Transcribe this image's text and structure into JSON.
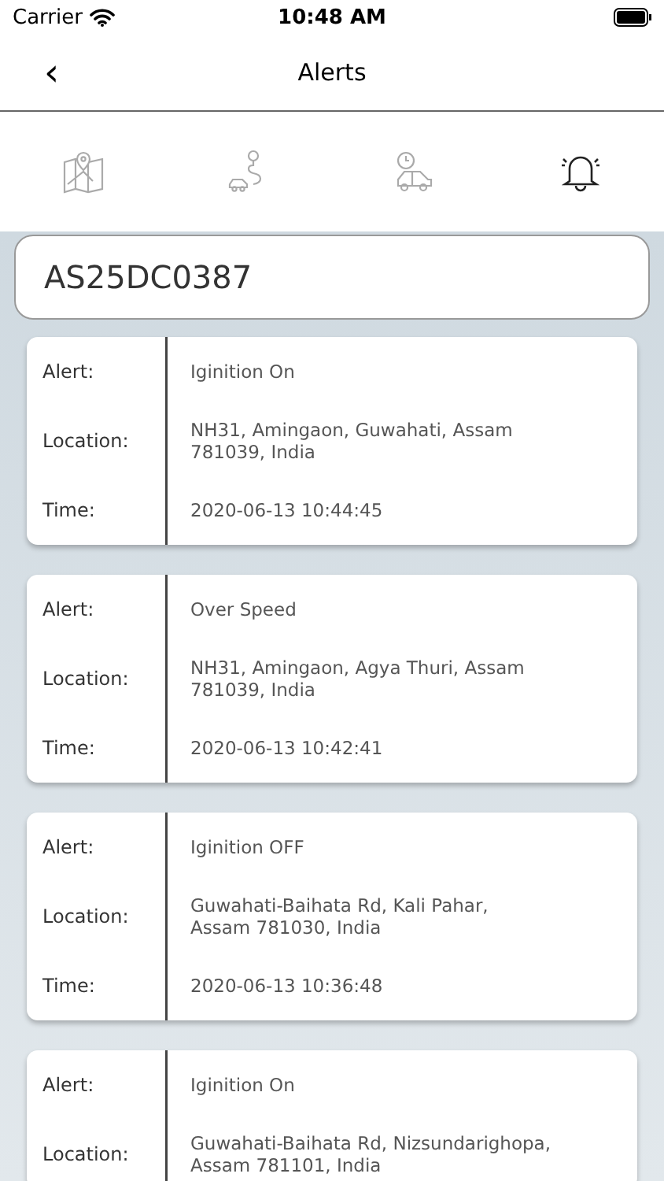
{
  "status_bar": {
    "carrier": "Carrier",
    "time": "10:48 AM"
  },
  "nav_bar": {
    "back": "‹",
    "title": "Alerts"
  },
  "tabs": [
    {
      "kind": "map",
      "selected": false
    },
    {
      "kind": "route",
      "selected": false
    },
    {
      "kind": "history",
      "selected": false
    },
    {
      "kind": "alerts",
      "selected": true
    }
  ],
  "vehicle": "AS25DC0387",
  "alerts": [
    {
      "fields": [
        {
          "label": "Alert:",
          "value": "Iginition On"
        },
        {
          "label": "Location:",
          "value": "NH31, Amingaon, Guwahati, Assam 781039, India"
        },
        {
          "label": "Time:",
          "value": "2020-06-13 10:44:45"
        }
      ]
    },
    {
      "fields": [
        {
          "label": "Alert:",
          "value": "Over Speed"
        },
        {
          "label": "Location:",
          "value": "NH31, Amingaon, Agya Thuri, Assam 781039, India"
        },
        {
          "label": "Time:",
          "value": "2020-06-13 10:42:41"
        }
      ]
    },
    {
      "fields": [
        {
          "label": "Alert:",
          "value": "Iginition OFF"
        },
        {
          "label": "Location:",
          "value": "Guwahati-Baihata Rd, Kali Pahar, Assam 781030, India"
        },
        {
          "label": "Time:",
          "value": "2020-06-13 10:36:48"
        }
      ]
    },
    {
      "fields": [
        {
          "label": "Alert:",
          "value": "Iginition On"
        },
        {
          "label": "Location:",
          "value": "Guwahati-Baihata Rd, Nizsundarighopa, Assam 781101, India"
        }
      ]
    }
  ]
}
